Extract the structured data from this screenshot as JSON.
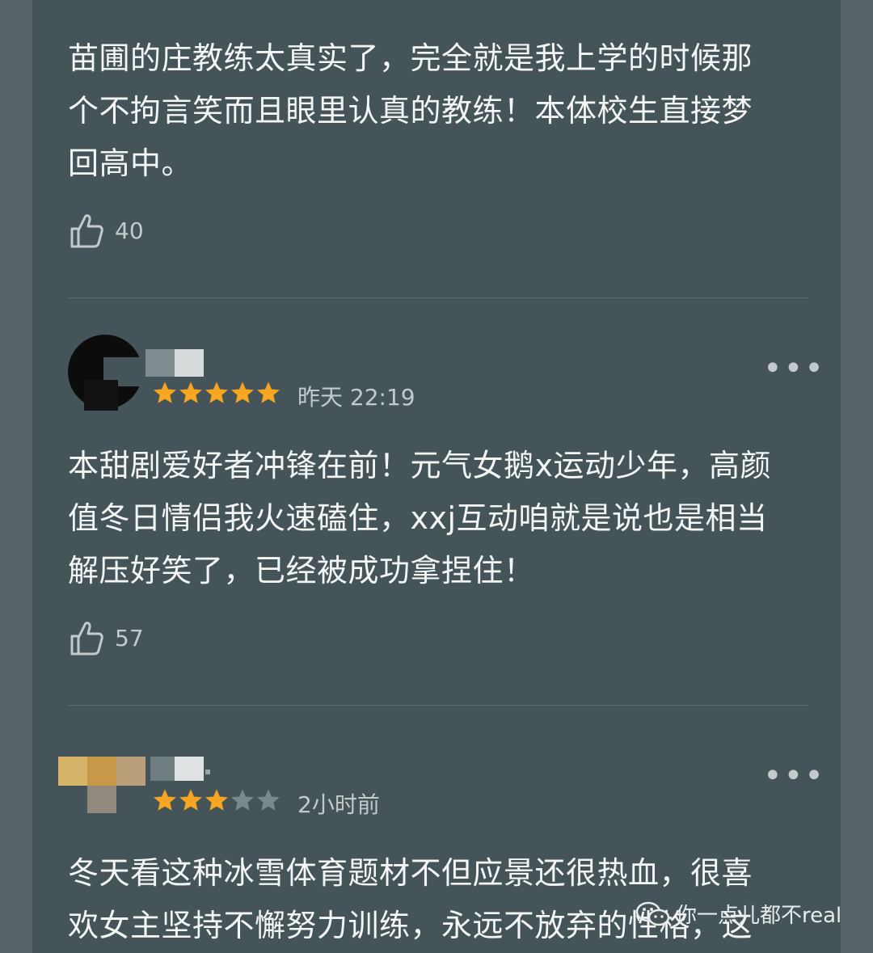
{
  "comments": [
    {
      "text_lines": [
        "苗圃的庄教练太真实了，完全就是我上学的时候那",
        "个不拘言笑而且眼里认真的教练！本体校生直接梦",
        "回高中。"
      ],
      "likes": "40"
    },
    {
      "rating": 5,
      "time": "昨天 22:19",
      "more": "•••",
      "text_lines": [
        "本甜剧爱好者冲锋在前！元气女鹅x运动少年，高颜",
        "值冬日情侣我火速磕住，xxj互动咱就是说也是相当",
        "解压好笑了，已经被成功拿捏住！"
      ],
      "likes": "57"
    },
    {
      "rating": 3,
      "time": "2小时前",
      "more": "•••",
      "text_lines": [
        "冬天看这种冰雪体育题材不但应景还很热血，很喜",
        "欢女主坚持不懈努力训练，永远不放弃的性格，这"
      ]
    }
  ],
  "watermark": {
    "text": "你一点儿都不real",
    "icon": "wechat-icon"
  },
  "colors": {
    "star_active": "#f6a623",
    "star_inactive": "#7a878b",
    "background": "#445459"
  }
}
